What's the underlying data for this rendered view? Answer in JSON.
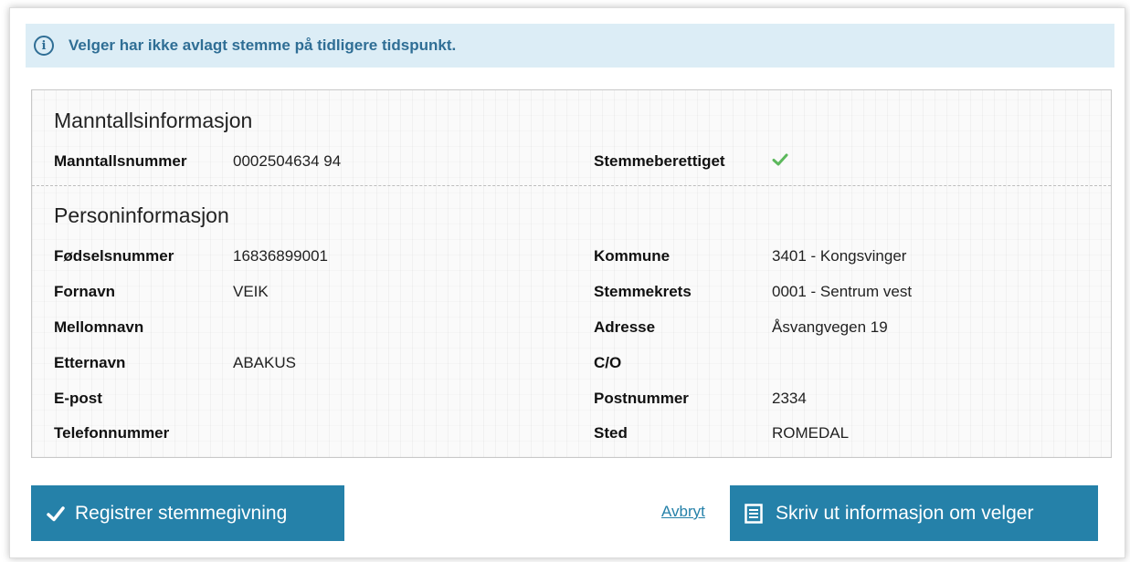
{
  "alert": {
    "icon": "info-icon",
    "message": "Velger har ikke avlagt stemme på tidligere tidspunkt."
  },
  "manntall": {
    "title": "Manntallsinformasjon",
    "number_label": "Manntallsnummer",
    "number_value": "0002504634 94",
    "eligible_label": "Stemmeberettiget",
    "eligible_icon": "check-icon",
    "eligible_color": "#5cb85c"
  },
  "person": {
    "title": "Personinformasjon",
    "left": [
      {
        "label": "Fødselsnummer",
        "value": "16836899001"
      },
      {
        "label": "Fornavn",
        "value": "VEIK"
      },
      {
        "label": "Mellomnavn",
        "value": ""
      },
      {
        "label": "Etternavn",
        "value": "ABAKUS"
      },
      {
        "label": "E-post",
        "value": ""
      },
      {
        "label": "Telefonnummer",
        "value": ""
      }
    ],
    "right": [
      {
        "label": "Kommune",
        "value": "3401 - Kongsvinger"
      },
      {
        "label": "Stemmekrets",
        "value": "0001 - Sentrum vest"
      },
      {
        "label": "Adresse",
        "value": "Åsvangvegen 19"
      },
      {
        "label": "C/O",
        "value": ""
      },
      {
        "label": "Postnummer",
        "value": "2334"
      },
      {
        "label": "Sted",
        "value": "ROMEDAL"
      }
    ]
  },
  "actions": {
    "register_label": "Registrer stemmegivning",
    "register_icon": "check-icon",
    "cancel_label": "Avbryt",
    "print_label": "Skriv ut informasjon om velger",
    "print_icon": "document-icon",
    "button_color": "#2581a9"
  }
}
